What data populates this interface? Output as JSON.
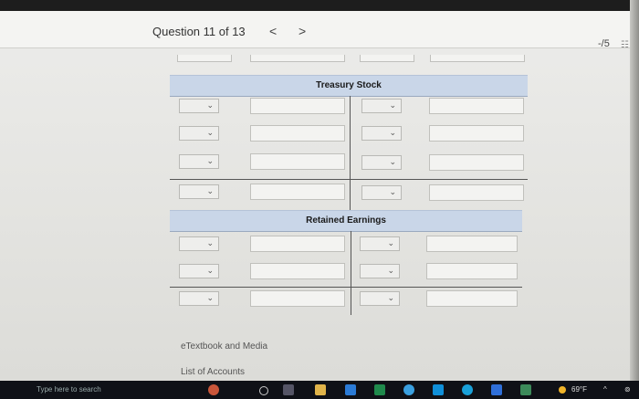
{
  "header": {
    "question_label": "Question 11 of 13",
    "prev_glyph": "<",
    "next_glyph": ">",
    "score": "-/5"
  },
  "ledgers": {
    "treasury_title": "Treasury Stock",
    "retained_title": "Retained Earnings"
  },
  "links": {
    "etextbook": "eTextbook and Media",
    "accounts": "List of Accounts"
  },
  "taskbar": {
    "search_placeholder": "Type here to search",
    "weather": "69°F"
  },
  "colors": {
    "ledger_header": "#c9d6e8",
    "taskbar": "#0f1117"
  }
}
